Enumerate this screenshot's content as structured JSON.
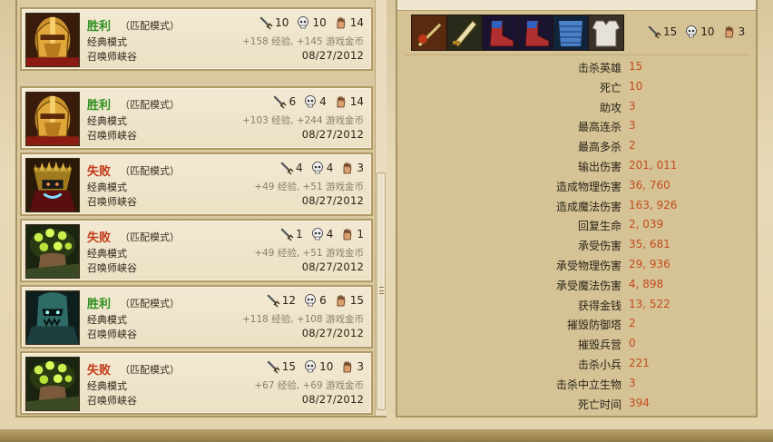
{
  "matches": [
    {
      "result": "胜利",
      "outcome": "win",
      "mode": "（匹配模式）",
      "queue": "经典模式",
      "map": "召唤师峡谷",
      "kills": "10",
      "deaths": "10",
      "assists": "14",
      "rewards": "+158 经验, +145 游戏金币",
      "date": "08/27/2012",
      "champion_icon": "golden-knight-portrait"
    },
    {
      "result": "胜利",
      "outcome": "win",
      "mode": "（匹配模式）",
      "queue": "经典模式",
      "map": "召唤师峡谷",
      "kills": "6",
      "deaths": "4",
      "assists": "14",
      "rewards": "+103 经验, +244 游戏金币",
      "date": "08/27/2012",
      "champion_icon": "golden-knight-portrait"
    },
    {
      "result": "失败",
      "outcome": "loss",
      "mode": "（匹配模式）",
      "queue": "经典模式",
      "map": "召唤师峡谷",
      "kills": "4",
      "deaths": "4",
      "assists": "3",
      "rewards": "+49 经验, +51 游戏金币",
      "date": "08/27/2012",
      "champion_icon": "dark-helm-portrait"
    },
    {
      "result": "失败",
      "outcome": "loss",
      "mode": "（匹配模式）",
      "queue": "经典模式",
      "map": "召唤师峡谷",
      "kills": "1",
      "deaths": "4",
      "assists": "1",
      "rewards": "+49 经验, +51 游戏金币",
      "date": "08/27/2012",
      "champion_icon": "green-eyes-portrait"
    },
    {
      "result": "胜利",
      "outcome": "win",
      "mode": "（匹配模式）",
      "queue": "经典模式",
      "map": "召唤师峡谷",
      "kills": "12",
      "deaths": "6",
      "assists": "15",
      "rewards": "+118 经验, +108 游戏金币",
      "date": "08/27/2012",
      "champion_icon": "teal-masked-portrait"
    },
    {
      "result": "失败",
      "outcome": "loss",
      "mode": "（匹配模式）",
      "queue": "经典模式",
      "map": "召唤师峡谷",
      "kills": "15",
      "deaths": "10",
      "assists": "3",
      "rewards": "+67 经验, +69 游戏金币",
      "date": "08/27/2012",
      "champion_icon": "green-eyes-portrait"
    }
  ],
  "detail": {
    "items": [
      "sword-item-icon",
      "blade-item-icon",
      "boots-item-icon",
      "boots-item-icon",
      "chainmail-item-icon",
      "armor-item-icon"
    ],
    "kills": "15",
    "deaths": "10",
    "assists": "3",
    "stats": [
      {
        "label": "击杀英雄",
        "value": "15"
      },
      {
        "label": "死亡",
        "value": "10"
      },
      {
        "label": "助攻",
        "value": "3"
      },
      {
        "label": "最高连杀",
        "value": "3"
      },
      {
        "label": "最高多杀",
        "value": "2"
      },
      {
        "label": "输出伤害",
        "value": "201, 011"
      },
      {
        "label": "造成物理伤害",
        "value": "36, 760"
      },
      {
        "label": "造成魔法伤害",
        "value": "163, 926"
      },
      {
        "label": "回复生命",
        "value": "2, 039"
      },
      {
        "label": "承受伤害",
        "value": "35, 681"
      },
      {
        "label": "承受物理伤害",
        "value": "29, 936"
      },
      {
        "label": "承受魔法伤害",
        "value": "4, 898"
      },
      {
        "label": "获得金钱",
        "value": "13, 522"
      },
      {
        "label": "摧毁防御塔",
        "value": "2"
      },
      {
        "label": "摧毁兵营",
        "value": "0"
      },
      {
        "label": "击杀小兵",
        "value": "221"
      },
      {
        "label": "击杀中立生物",
        "value": "3"
      },
      {
        "label": "死亡时间",
        "value": "394"
      }
    ]
  },
  "colors": {
    "win": "#2e8f1e",
    "loss": "#c23a1a",
    "stat_value": "#c44b1c"
  }
}
